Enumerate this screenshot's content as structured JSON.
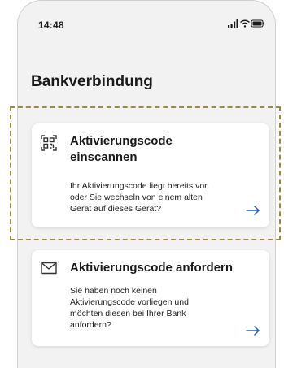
{
  "status_bar": {
    "time": "14:48",
    "icons": [
      "signal-icon",
      "wifi-icon",
      "battery-icon"
    ]
  },
  "page": {
    "title": "Bankverbindung"
  },
  "cards": [
    {
      "icon": "qr-scan-icon",
      "title": "Aktivierungscode einscannen",
      "title_line1": "Aktivierungscode",
      "title_line2": "einscannen",
      "desc_lines": [
        "Ihr Aktivierungscode liegt bereits vor,",
        "oder Sie wechseln von einem alten",
        "Gerät auf dieses Gerät?"
      ],
      "action_icon": "arrow-right-icon"
    },
    {
      "icon": "envelope-icon",
      "title": "Aktivierungscode anfordern",
      "desc_lines": [
        "Sie haben noch keinen",
        "Aktivierungscode vorliegen und",
        "möchten diesen bei Ihrer Bank",
        "anfordern?"
      ],
      "action_icon": "arrow-right-icon"
    }
  ],
  "colors": {
    "accent": "#1f5fbf",
    "background": "#f2f2f2",
    "card": "#ffffff",
    "highlight_border": "#a08a3c"
  }
}
